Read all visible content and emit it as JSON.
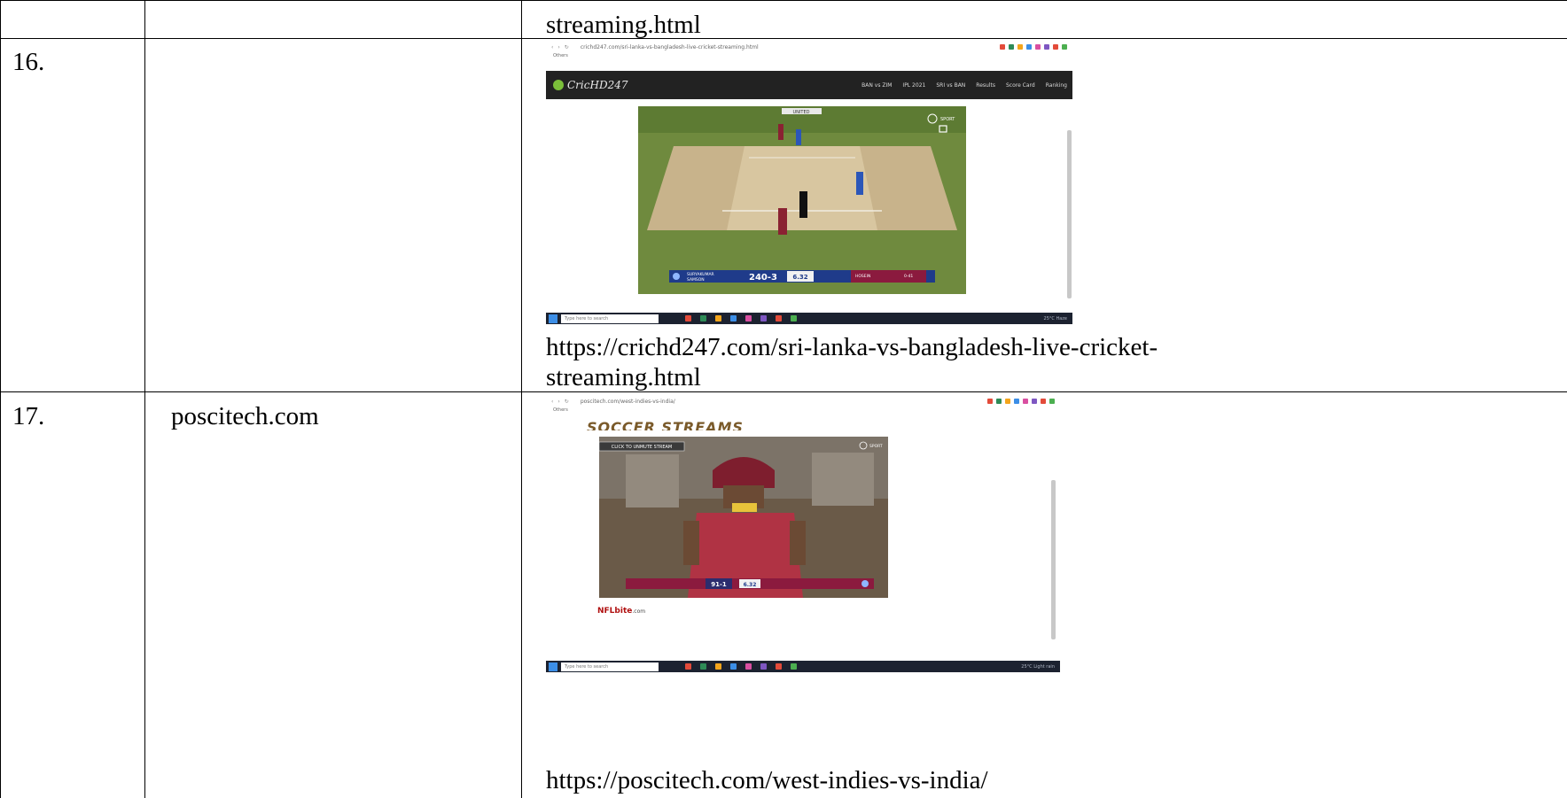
{
  "rows": [
    {
      "num": "",
      "site": "",
      "url_tail": "streaming.html"
    },
    {
      "num": "16.",
      "site": "",
      "url_line1": "https://crichd247.com/sri-lanka-vs-bangladesh-live-cricket-",
      "url_line2": "streaming.html",
      "screenshot": {
        "browser_url": "crichd247.com/sri-lanka-vs-bangladesh-live-cricket-streaming.html",
        "bookmark": "Others",
        "logo": "CricHD247",
        "nav": [
          "BAN vs ZIM",
          "IPL 2021",
          "SRI vs BAN",
          "Results",
          "Score Card",
          "Ranking"
        ],
        "banner": "UNITED",
        "score": "240-3",
        "run_rate": "6.32",
        "bowler": "HOSEIN",
        "bowler_figures": "0-41",
        "batter1": "SURYAKUMAR",
        "batter2": "SAMSON",
        "watermark": "SPORT",
        "taskbar_search": "Type here to search",
        "tray_text": "25°C Haze",
        "icon_colors": [
          "#e34b3a",
          "#2e8b57",
          "#f4a51c",
          "#3c8ee6",
          "#d94fa1",
          "#7e57c2",
          "#e34b3a",
          "#4caf50"
        ]
      }
    },
    {
      "num": "17.",
      "site": "poscitech.com",
      "url_line1": "https://poscitech.com/west-indies-vs-india/",
      "screenshot": {
        "browser_url": "poscitech.com/west-indies-vs-india/",
        "bookmark": "Others",
        "header_text": "SOCCER STREAMS",
        "unmute": "CLICK TO UNMUTE STREAM",
        "score": "91-1",
        "run_rate": "6.32",
        "brand": "NFLbite",
        "brand_suffix": ".com",
        "watermark": "SPORT",
        "taskbar_search": "Type here to search",
        "tray_text": "25°C Light rain",
        "icon_colors": [
          "#e34b3a",
          "#2e8b57",
          "#f4a51c",
          "#3c8ee6",
          "#d94fa1",
          "#7e57c2",
          "#e34b3a",
          "#4caf50"
        ]
      }
    }
  ]
}
